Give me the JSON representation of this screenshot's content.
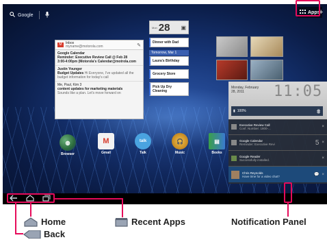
{
  "home_screen": {
    "search": {
      "label": "Google",
      "voice_icon": "mic-icon"
    },
    "apps_label": "Apps",
    "add_label": "+",
    "gmail_widget": {
      "header_title": "Inbox",
      "header_account": "myname@motorola.com",
      "messages": [
        {
          "sender": "Google Calendar",
          "subject": "Reminder: Executive Review Call @ Feb 28",
          "snippet": "3:00-4:00pm (Motorola's Calendar@motrola.com"
        },
        {
          "sender": "Justin Younger",
          "subject": "Budget Updates",
          "snippet": "Hi Everyone, I've updated all the budget information for today's call"
        },
        {
          "sender": "Me, Paul, Kim 3",
          "subject": "content updates for marketing materials",
          "snippet": "Sounds like a plan. Let's move forward on"
        }
      ]
    },
    "calendar_widget": {
      "month": "Mon",
      "date": "28",
      "events": [
        "Dinner with Dad",
        "Laura's Birthday",
        "Grocery Store",
        "Pick Up Dry Cleaning"
      ],
      "day_header": "Tomorrow, Mar 1"
    },
    "clock_widget": {
      "date_line1": "Monday, February",
      "date_line2": "28, 2011",
      "time": "11:05",
      "battery": "100%"
    },
    "notifications": [
      {
        "title": "Executive Review Call",
        "body": "Conf. Number: 1800-...",
        "icon": "calendar-icon"
      },
      {
        "title": "Google Calendar",
        "body": "Reminder: Executive Revi",
        "icon": "calendar-icon",
        "count": "5"
      },
      {
        "title": "Google Reader",
        "body": "Successfully installed.",
        "icon": "download-icon"
      },
      {
        "title": "Chris Reynolds",
        "body": "Have time for a video chat?",
        "icon": "avatar"
      }
    ],
    "dock": [
      {
        "label": "Browser",
        "icon": "globe-icon",
        "color": "#2b6a3c"
      },
      {
        "label": "Gmail",
        "icon": "gmail-icon",
        "color": "#d63a2a"
      },
      {
        "label": "Talk",
        "icon": "talk-icon",
        "color": "#4aa3e0"
      },
      {
        "label": "Music",
        "icon": "headphones-icon",
        "color": "#e29a14"
      },
      {
        "label": "Books",
        "icon": "books-icon",
        "color": "#3aa04a"
      }
    ]
  },
  "callouts": {
    "home": "Home",
    "back": "Back",
    "recent_apps": "Recent Apps",
    "notification_panel": "Notification Panel"
  },
  "colors": {
    "accent": "#e60a5a",
    "wallpaper": "#173678"
  }
}
